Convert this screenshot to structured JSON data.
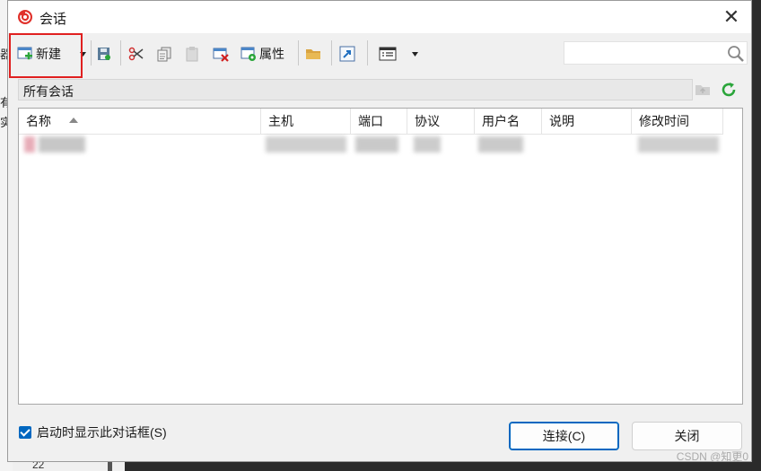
{
  "window": {
    "title": "会话"
  },
  "toolbar": {
    "new_label": "新建",
    "properties_label": "属性"
  },
  "folder_bar": {
    "path": "所有会话"
  },
  "table": {
    "columns": [
      "名称",
      "主机",
      "端口",
      "协议",
      "用户名",
      "说明",
      "修改时间"
    ]
  },
  "footer": {
    "show_on_startup": "启动时显示此对话框(S)",
    "connect_label": "连接(C)",
    "close_label": "关闭"
  },
  "background": {
    "left_chars": [
      "器",
      "有",
      "实"
    ],
    "bottom_number": "22"
  },
  "watermark": "CSDN @知更0",
  "colors": {
    "highlight": "#e02020",
    "accent": "#0067c0",
    "refresh": "#2aa53a"
  }
}
